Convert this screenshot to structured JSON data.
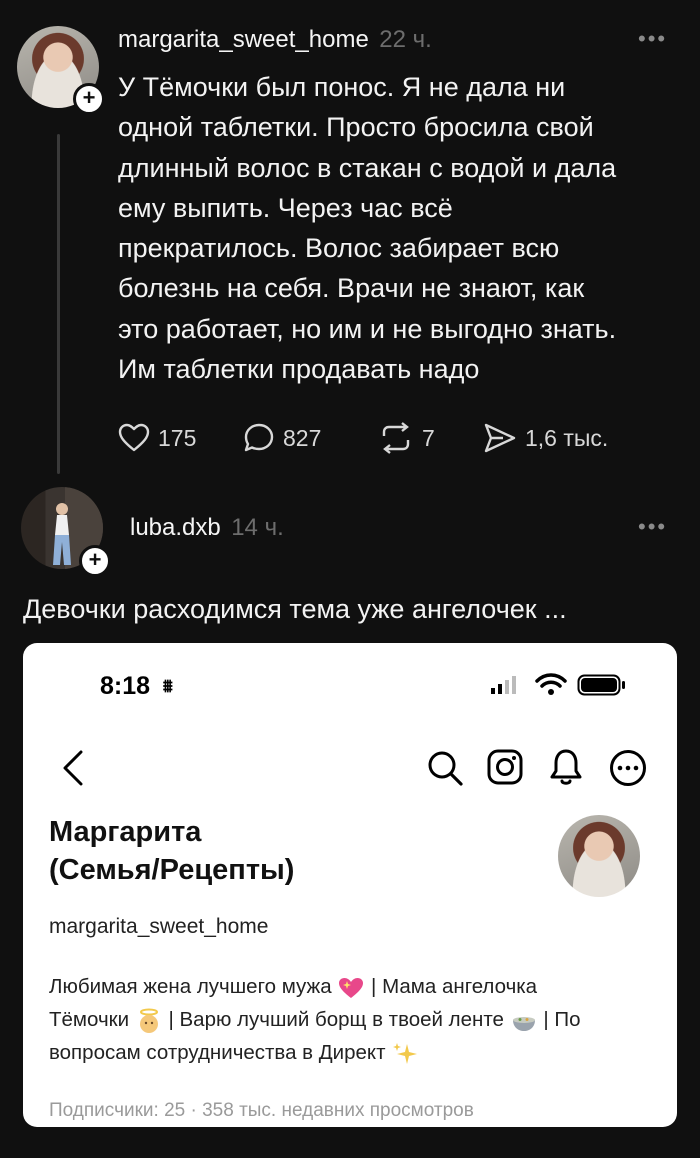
{
  "post1": {
    "username": "margarita_sweet_home",
    "time": "22 ч.",
    "more_icon": "more-dots-icon",
    "text_lines": [
      "У Тёмочки был понос. Я не дала ни",
      "одной таблетки. Просто бросила свой",
      "длинный волос в стакан с водой и дала",
      "ему выпить. Через час всё",
      "прекратилось. Волос забирает всю",
      "болезнь на себя. Врачи не знают, как",
      "это работает, но им и не выгодно знать.",
      "Им таблетки продавать надо"
    ],
    "likes": "175",
    "comments": "827",
    "reposts": "7",
    "shares": "1,6 тыс."
  },
  "post2": {
    "username": "luba.dxb",
    "time": "14 ч.",
    "caption": "Девочки расходимся тема уже ангелочек ..."
  },
  "screenshot": {
    "status_time": "8:18",
    "profile_name_line1": "Маргарита",
    "profile_name_line2": "(Семья/Рецепты)",
    "handle": "margarita_sweet_home",
    "bio_line1": "Любимая жена лучшего мужа",
    "bio_line1_tail": "| Мама ангелочка",
    "bio_line2_a": "Тёмочки",
    "bio_line2_b": "| Варю лучший борщ в твоей ленте",
    "bio_line2_c": "| По",
    "bio_line3": "вопросам сотрудничества в Директ",
    "followers": "Подписчики: 25 · 358 тыс. недавних просмотров"
  },
  "colors": {
    "background": "#101010",
    "muted": "#6d6d6d",
    "card": "#ffffff",
    "heart_emoji": "#e8488a",
    "sparkle": "#f2c94c"
  }
}
